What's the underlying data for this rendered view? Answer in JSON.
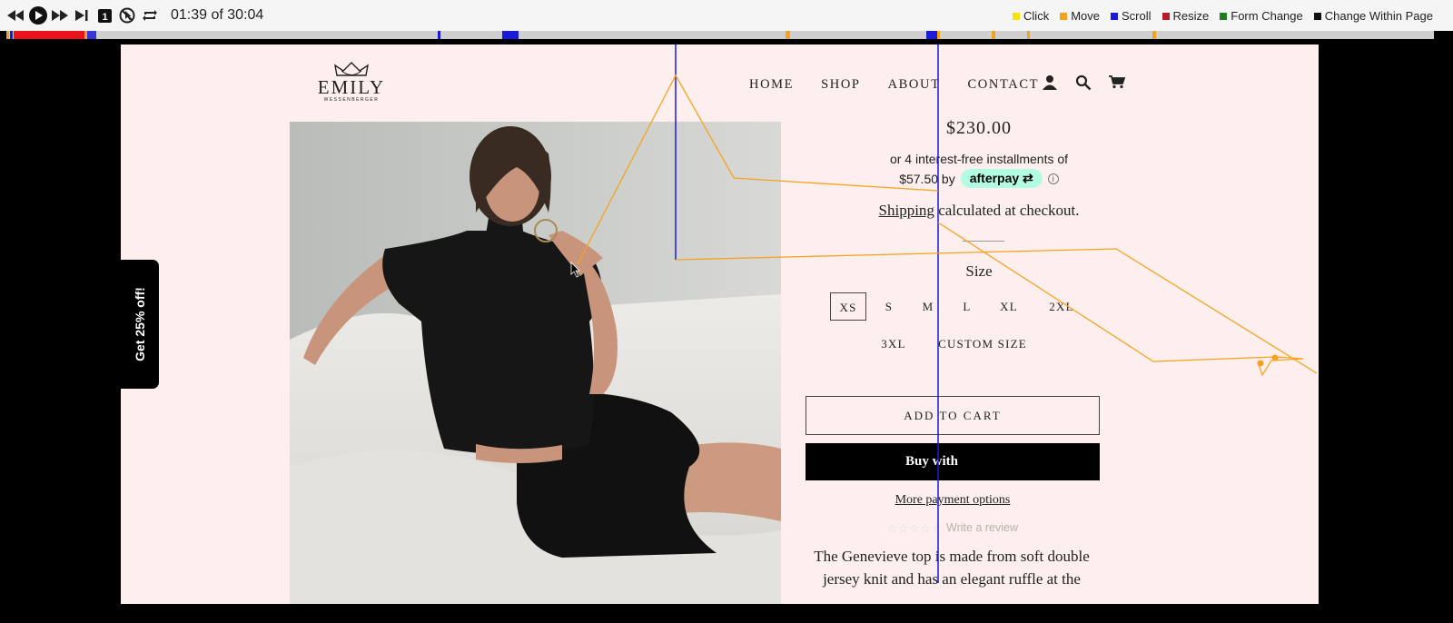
{
  "player": {
    "time_display": "01:39 of 30:04",
    "skip_label": "1"
  },
  "legend": [
    {
      "label": "Click",
      "color": "#f4e20d"
    },
    {
      "label": "Move",
      "color": "#f5a31e"
    },
    {
      "label": "Scroll",
      "color": "#1a1adb"
    },
    {
      "label": "Resize",
      "color": "#b51e2a"
    },
    {
      "label": "Form Change",
      "color": "#1f7d1f"
    },
    {
      "label": "Change Within Page",
      "color": "#111111"
    }
  ],
  "site": {
    "logo_name": "EMILY",
    "logo_sub": "WESSENBERGER",
    "nav": [
      "HOME",
      "SHOP",
      "ABOUT",
      "CONTACT"
    ],
    "promo": "Get 25% off!",
    "product": {
      "price": "$230.00",
      "afterpay_line1": "or 4 interest-free installments of",
      "afterpay_amount": "$57.50 by",
      "afterpay_brand": "afterpay",
      "afterpay_info": "i",
      "shipping_link": "Shipping",
      "shipping_rest": " calculated at checkout.",
      "size_label": "Size",
      "sizes": [
        "XS",
        "S",
        "M",
        "L",
        "XL",
        "2XL",
        "3XL",
        "CUSTOM SIZE"
      ],
      "add_to_cart": "ADD TO CART",
      "buy_with": "Buy with",
      "more_payment": "More payment options",
      "stars": "☆☆☆☆☆",
      "write_review": "Write a review",
      "description": "The Genevieve top is made from soft double jersey knit and has an elegant ruffle at the"
    }
  }
}
